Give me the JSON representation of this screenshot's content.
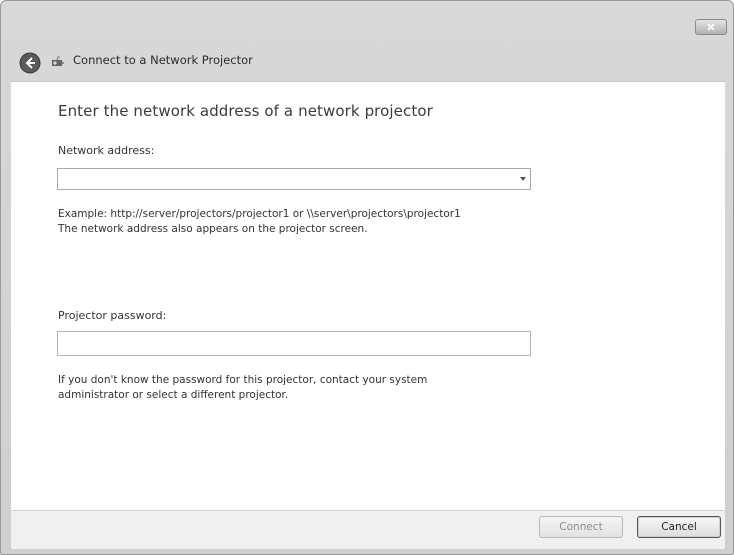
{
  "window": {
    "title": "Connect to a Network Projector"
  },
  "main": {
    "heading": "Enter the network address of a network projector",
    "network_address": {
      "label": "Network address:",
      "value": "",
      "example": "Example: http://server/projectors/projector1  or \\\\server\\projectors\\projector1",
      "note": "The network address also appears on the projector screen."
    },
    "password": {
      "label": "Projector password:",
      "value": "",
      "help_line1": "If you don't know the password for this projector, contact your system",
      "help_line2": "administrator or select a different projector."
    }
  },
  "footer": {
    "connect_label": "Connect",
    "cancel_label": "Cancel"
  },
  "icons": {
    "back": "back-arrow-icon",
    "app": "network-projector-icon",
    "close": "close-icon",
    "dropdown": "chevron-down-icon"
  }
}
